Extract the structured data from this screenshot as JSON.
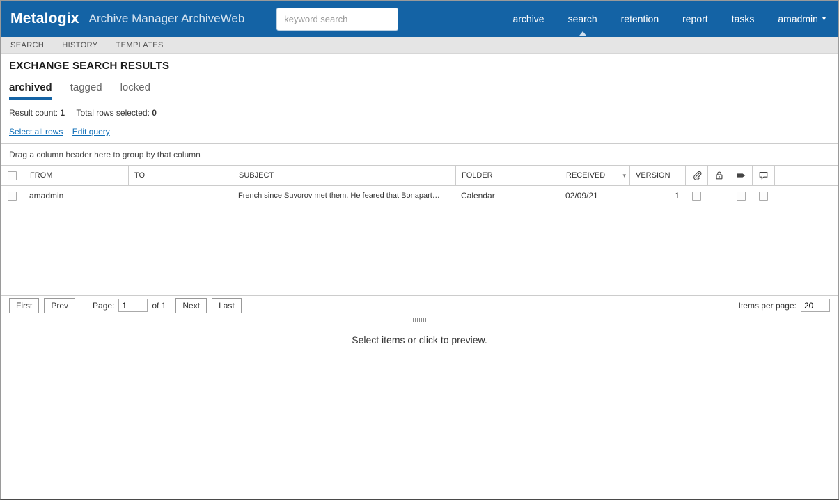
{
  "header": {
    "brand": "Metalogix",
    "product": "Archive Manager ArchiveWeb",
    "search_placeholder": "keyword search",
    "nav": [
      {
        "label": "archive",
        "active": false
      },
      {
        "label": "search",
        "active": true
      },
      {
        "label": "retention",
        "active": false
      },
      {
        "label": "report",
        "active": false
      },
      {
        "label": "tasks",
        "active": false
      }
    ],
    "user": "amadmin"
  },
  "subnav": {
    "items": [
      {
        "label": "SEARCH"
      },
      {
        "label": "HISTORY"
      },
      {
        "label": "TEMPLATES"
      }
    ]
  },
  "page": {
    "title": "EXCHANGE SEARCH RESULTS"
  },
  "tabs": [
    {
      "label": "archived",
      "active": true
    },
    {
      "label": "tagged",
      "active": false
    },
    {
      "label": "locked",
      "active": false
    }
  ],
  "results": {
    "result_count_label": "Result count:",
    "result_count": "1",
    "rows_selected_label": "Total rows selected:",
    "rows_selected": "0",
    "select_all_link": "Select all rows",
    "edit_query_link": "Edit query",
    "group_hint": "Drag a column header here to group by that column"
  },
  "table": {
    "columns": {
      "from": "FROM",
      "to": "TO",
      "subject": "SUBJECT",
      "folder": "FOLDER",
      "received": "RECEIVED",
      "version": "VERSION"
    },
    "icon_columns": [
      "paperclip",
      "lock",
      "tag",
      "comment"
    ],
    "rows": [
      {
        "from": "amadmin",
        "to": "",
        "subject": "French since Suvorov met them. He feared that Bonapart…",
        "folder": "Calendar",
        "received": "02/09/21",
        "version": "1"
      }
    ]
  },
  "pagination": {
    "first": "First",
    "prev": "Prev",
    "page_label": "Page:",
    "page_value": "1",
    "of_label": "of 1",
    "next": "Next",
    "last": "Last",
    "items_per_page_label": "Items per page:",
    "items_per_page_value": "20"
  },
  "preview": {
    "hint": "Select items or click to preview."
  },
  "colors": {
    "header_bg": "#1463a5",
    "link": "#0d6db7",
    "active_tab_underline": "#1463a5"
  }
}
